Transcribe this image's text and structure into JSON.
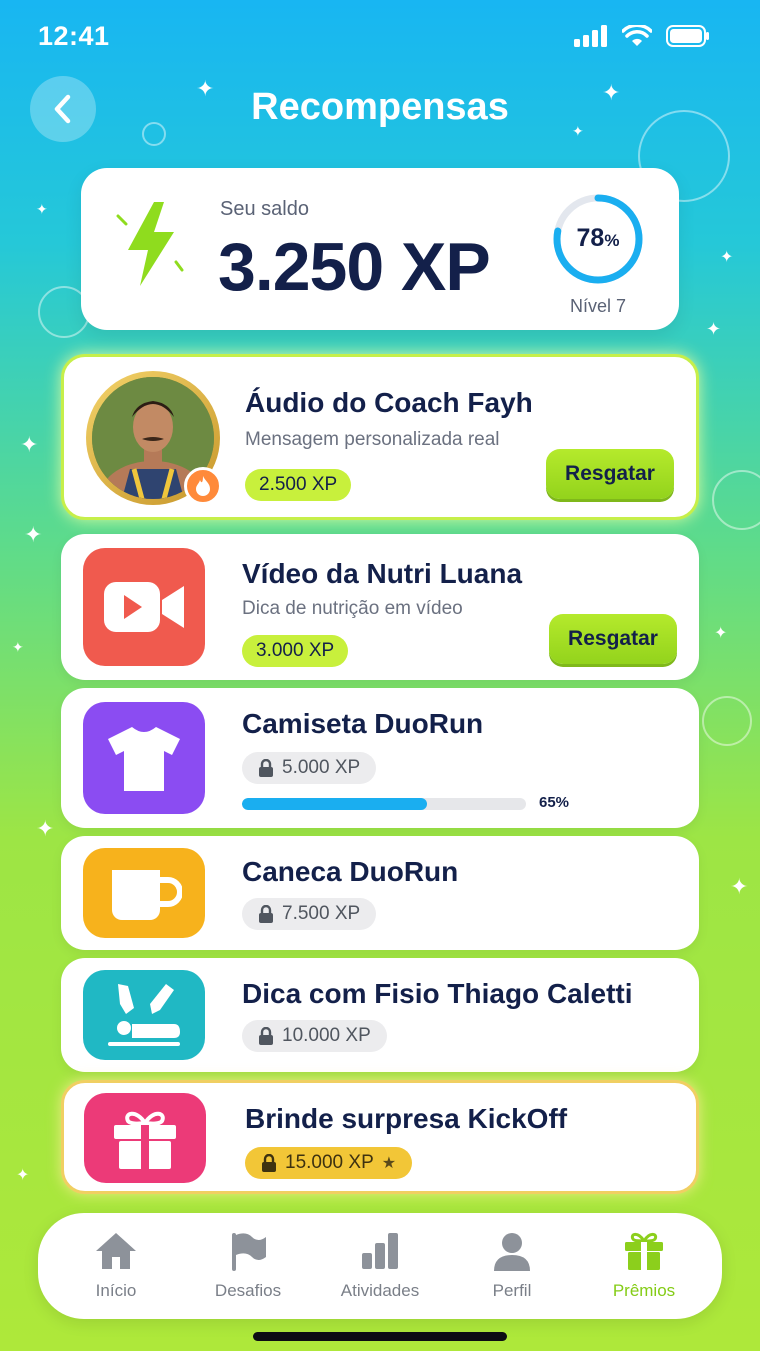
{
  "status_bar": {
    "time": "12:41"
  },
  "header": {
    "title": "Recompensas"
  },
  "balance": {
    "label": "Seu saldo",
    "value": "3.250 XP",
    "level_percent": "78",
    "level_percent_unit": "%",
    "level_progress": 0.78,
    "level_label": "Nível 7"
  },
  "rewards": [
    {
      "title": "Áudio do Coach Fayh",
      "subtitle": "Mensagem personalizada real",
      "cost": "2.500 XP",
      "action": "Resgatar",
      "icon": "coach-avatar"
    },
    {
      "title": "Vídeo da Nutri Luana",
      "subtitle": "Dica de nutrição em vídeo",
      "cost": "3.000 XP",
      "action": "Resgatar",
      "icon": "video-camera-icon",
      "tile_color": "#f05a4e"
    },
    {
      "title": "Camiseta DuoRun",
      "cost": "5.000 XP",
      "progress": 0.65,
      "progress_label": "65%",
      "icon": "tshirt-icon",
      "tile_color": "#8b4cf2"
    },
    {
      "title": "Caneca DuoRun",
      "cost": "7.500 XP",
      "icon": "mug-icon",
      "tile_color": "#f7b21c"
    },
    {
      "title": "Dica com Fisio Thiago Caletti",
      "cost": "10.000 XP",
      "icon": "massage-icon",
      "tile_color": "#20b8c4"
    },
    {
      "title": "Brinde surpresa KickOff",
      "cost": "15.000 XP",
      "icon": "gift-icon",
      "tile_color": "#ec3a78"
    }
  ],
  "nav": {
    "items": [
      {
        "label": "Início",
        "icon": "home-icon"
      },
      {
        "label": "Desafios",
        "icon": "flag-icon"
      },
      {
        "label": "Atividades",
        "icon": "bar-chart-icon"
      },
      {
        "label": "Perfil",
        "icon": "user-icon"
      },
      {
        "label": "Prêmios",
        "icon": "gift-icon",
        "active": true
      }
    ]
  },
  "colors": {
    "accent_green": "#a6e022",
    "accent_blue": "#1aaef0",
    "text_dark": "#13204a"
  }
}
